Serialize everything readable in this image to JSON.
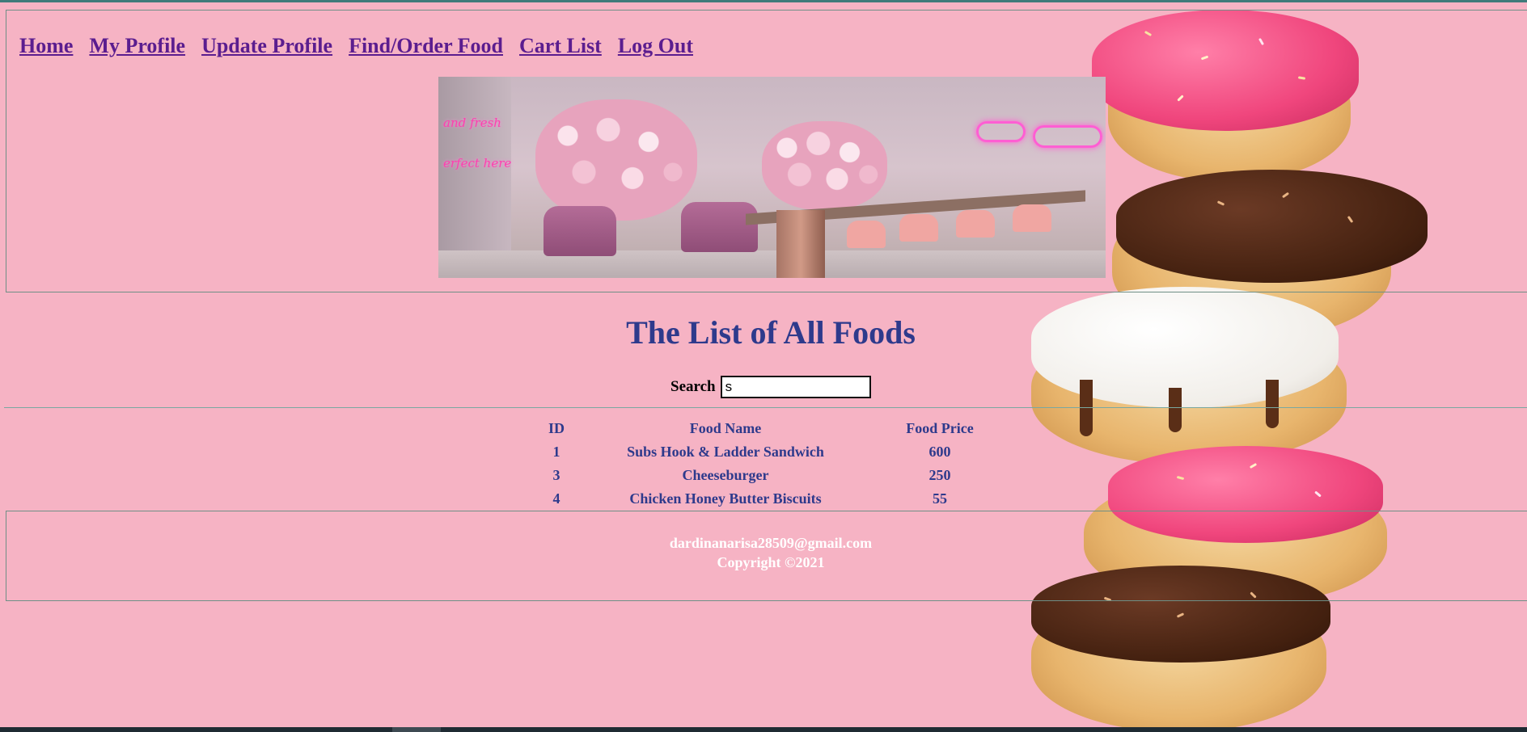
{
  "nav": {
    "items": [
      {
        "label": "Home"
      },
      {
        "label": "My Profile"
      },
      {
        "label": "Update Profile"
      },
      {
        "label": "Find/Order Food"
      },
      {
        "label": "Cart List"
      },
      {
        "label": "Log Out"
      }
    ]
  },
  "banner": {
    "neon_line_1": "and fresh",
    "neon_line_2": "erfect here"
  },
  "main": {
    "title": "The List of All Foods",
    "search": {
      "label": "Search",
      "value": "s",
      "placeholder": ""
    },
    "table": {
      "headers": [
        "ID",
        "Food Name",
        "Food Price"
      ],
      "rows": [
        {
          "id": "1",
          "name": "Subs Hook & Ladder Sandwich",
          "price": "600"
        },
        {
          "id": "3",
          "name": "Cheeseburger",
          "price": "250"
        },
        {
          "id": "4",
          "name": "Chicken Honey Butter Biscuits",
          "price": "55"
        }
      ]
    }
  },
  "footer": {
    "email": "dardinanarisa28509@gmail.com",
    "copyright": "Copyright ©2021"
  },
  "colors": {
    "background": "#f6b3c4",
    "link": "#5b1d8f",
    "heading": "#2e3a8c",
    "footer_text": "#ffffff"
  }
}
